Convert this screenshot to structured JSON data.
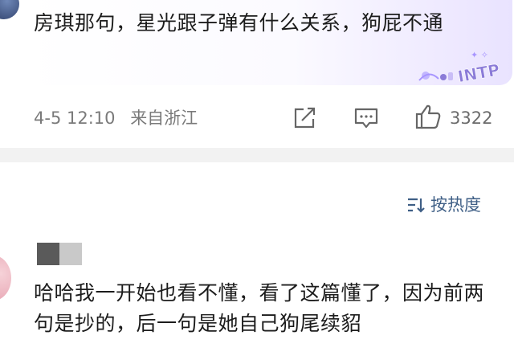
{
  "top_comment": {
    "text": "房琪那句，星光跟子弹有什么关系，狗屁不通",
    "badge_text": "INTP",
    "timestamp": "4-5 12:10",
    "location": "来自浙江",
    "like_count": "3322",
    "icons": [
      "share-icon",
      "comment-icon",
      "like-icon"
    ]
  },
  "sort": {
    "label": "按热度",
    "icon": "sort-icon"
  },
  "reply": {
    "text": "哈哈我一开始也看不懂，看了这篇懂了，因为前两句是抄的，后一句是她自己狗尾续貂"
  },
  "colors": {
    "accent": "#3f5f86",
    "badge": "#8b7bd8",
    "divider": "#f2f2f2"
  }
}
